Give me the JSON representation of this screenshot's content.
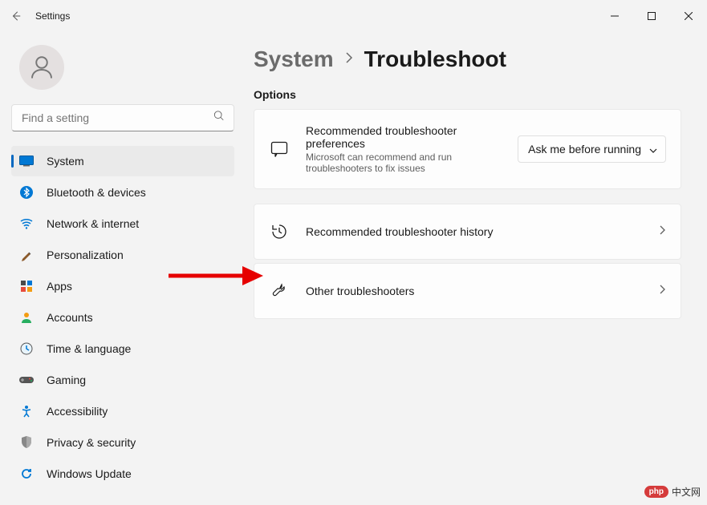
{
  "window": {
    "title": "Settings"
  },
  "search": {
    "placeholder": "Find a setting"
  },
  "sidebar": {
    "items": [
      {
        "label": "System"
      },
      {
        "label": "Bluetooth & devices"
      },
      {
        "label": "Network & internet"
      },
      {
        "label": "Personalization"
      },
      {
        "label": "Apps"
      },
      {
        "label": "Accounts"
      },
      {
        "label": "Time & language"
      },
      {
        "label": "Gaming"
      },
      {
        "label": "Accessibility"
      },
      {
        "label": "Privacy & security"
      },
      {
        "label": "Windows Update"
      }
    ]
  },
  "breadcrumb": {
    "parent": "System",
    "current": "Troubleshoot"
  },
  "section": {
    "options": "Options"
  },
  "cards": {
    "prefs": {
      "title": "Recommended troubleshooter preferences",
      "desc": "Microsoft can recommend and run troubleshooters to fix issues",
      "select_value": "Ask me before running"
    },
    "history": {
      "title": "Recommended troubleshooter history"
    },
    "other": {
      "title": "Other troubleshooters"
    }
  },
  "watermark": {
    "badge": "php",
    "text": "中文网"
  }
}
